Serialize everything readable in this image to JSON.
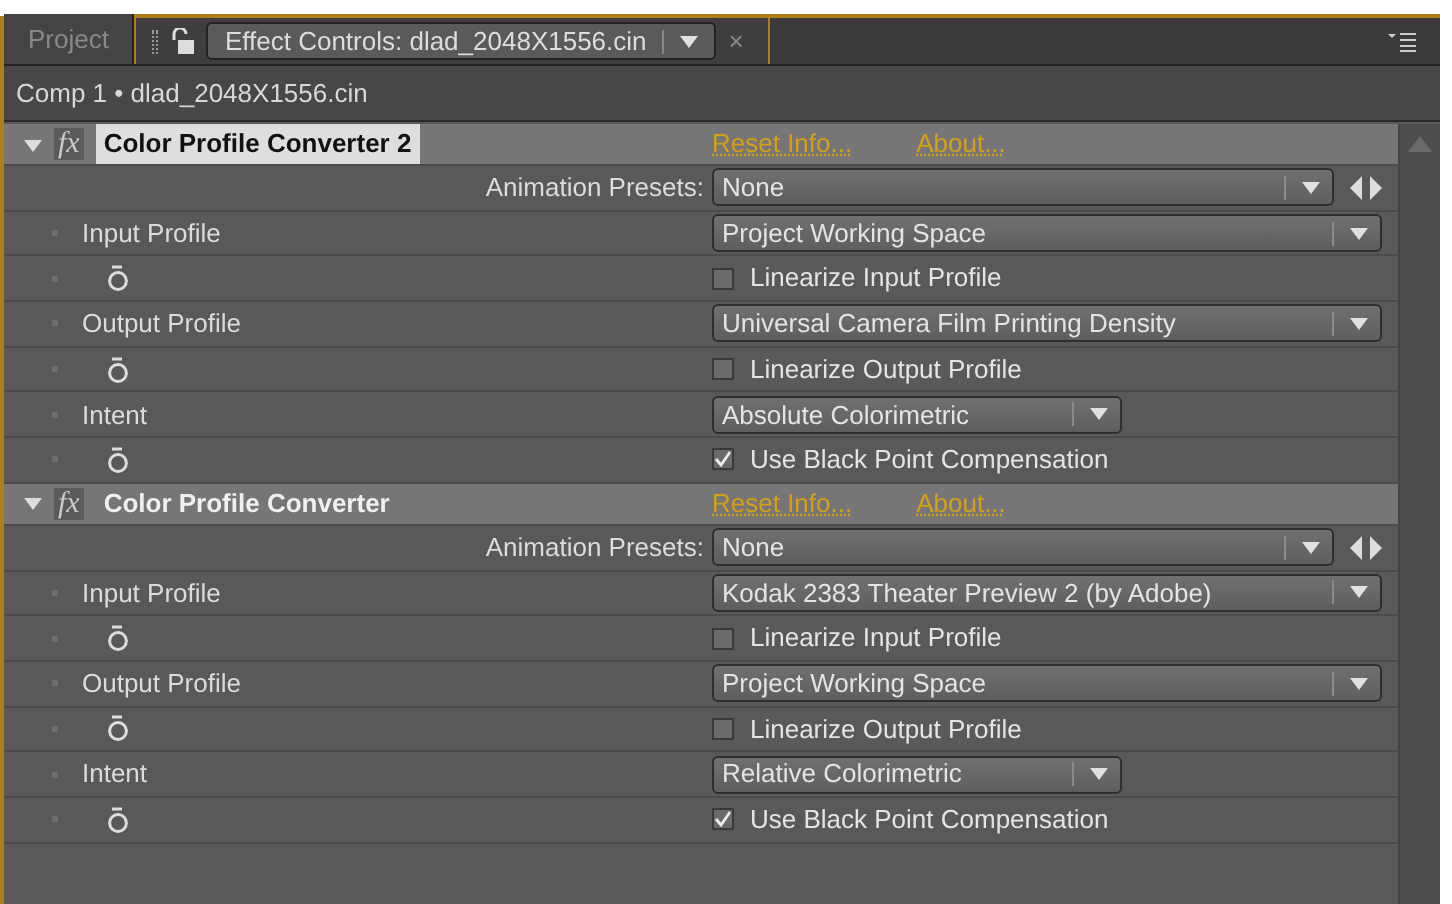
{
  "tabs": [
    {
      "label": "Project",
      "selected": false
    },
    {
      "label": "Effect Controls: dlad_2048X1556.cin",
      "selected": true
    }
  ],
  "close_symbol": "×",
  "breadcrumb": "Comp 1 • dlad_2048X1556.cin",
  "effects": [
    {
      "badge": "fx",
      "name": "Color Profile Converter 2",
      "selected": true,
      "expanded": true,
      "links": [
        "Reset Info...",
        "About..."
      ],
      "presets": {
        "label": "Animation Presets:",
        "value": "None"
      },
      "properties": [
        {
          "kind": "dropdown",
          "label": "Input Profile",
          "value": "Project Working Space"
        },
        {
          "kind": "checkbox",
          "label": "Linearize Input Profile",
          "checked": false
        },
        {
          "kind": "dropdown",
          "label": "Output Profile",
          "value": "Universal Camera Film Printing Density"
        },
        {
          "kind": "checkbox",
          "label": "Linearize Output Profile",
          "checked": false
        },
        {
          "kind": "small-dropdown",
          "label": "Intent",
          "value": "Absolute Colorimetric"
        },
        {
          "kind": "checkbox",
          "label": "Use Black Point Compensation",
          "checked": true
        }
      ]
    },
    {
      "badge": "fx",
      "name": "Color Profile Converter",
      "selected": false,
      "expanded": true,
      "links": [
        "Reset Info...",
        "About..."
      ],
      "presets": {
        "label": "Animation Presets:",
        "value": "None"
      },
      "properties": [
        {
          "kind": "dropdown",
          "label": "Input Profile",
          "value": "Kodak 2383 Theater Preview 2 (by Adobe)"
        },
        {
          "kind": "checkbox",
          "label": "Linearize Input Profile",
          "checked": false
        },
        {
          "kind": "dropdown",
          "label": "Output Profile",
          "value": "Project Working Space"
        },
        {
          "kind": "checkbox",
          "label": "Linearize Output Profile",
          "checked": false
        },
        {
          "kind": "small-dropdown",
          "label": "Intent",
          "value": "Relative Colorimetric"
        },
        {
          "kind": "checkbox",
          "label": "Use Black Point Compensation",
          "checked": true
        }
      ]
    }
  ]
}
